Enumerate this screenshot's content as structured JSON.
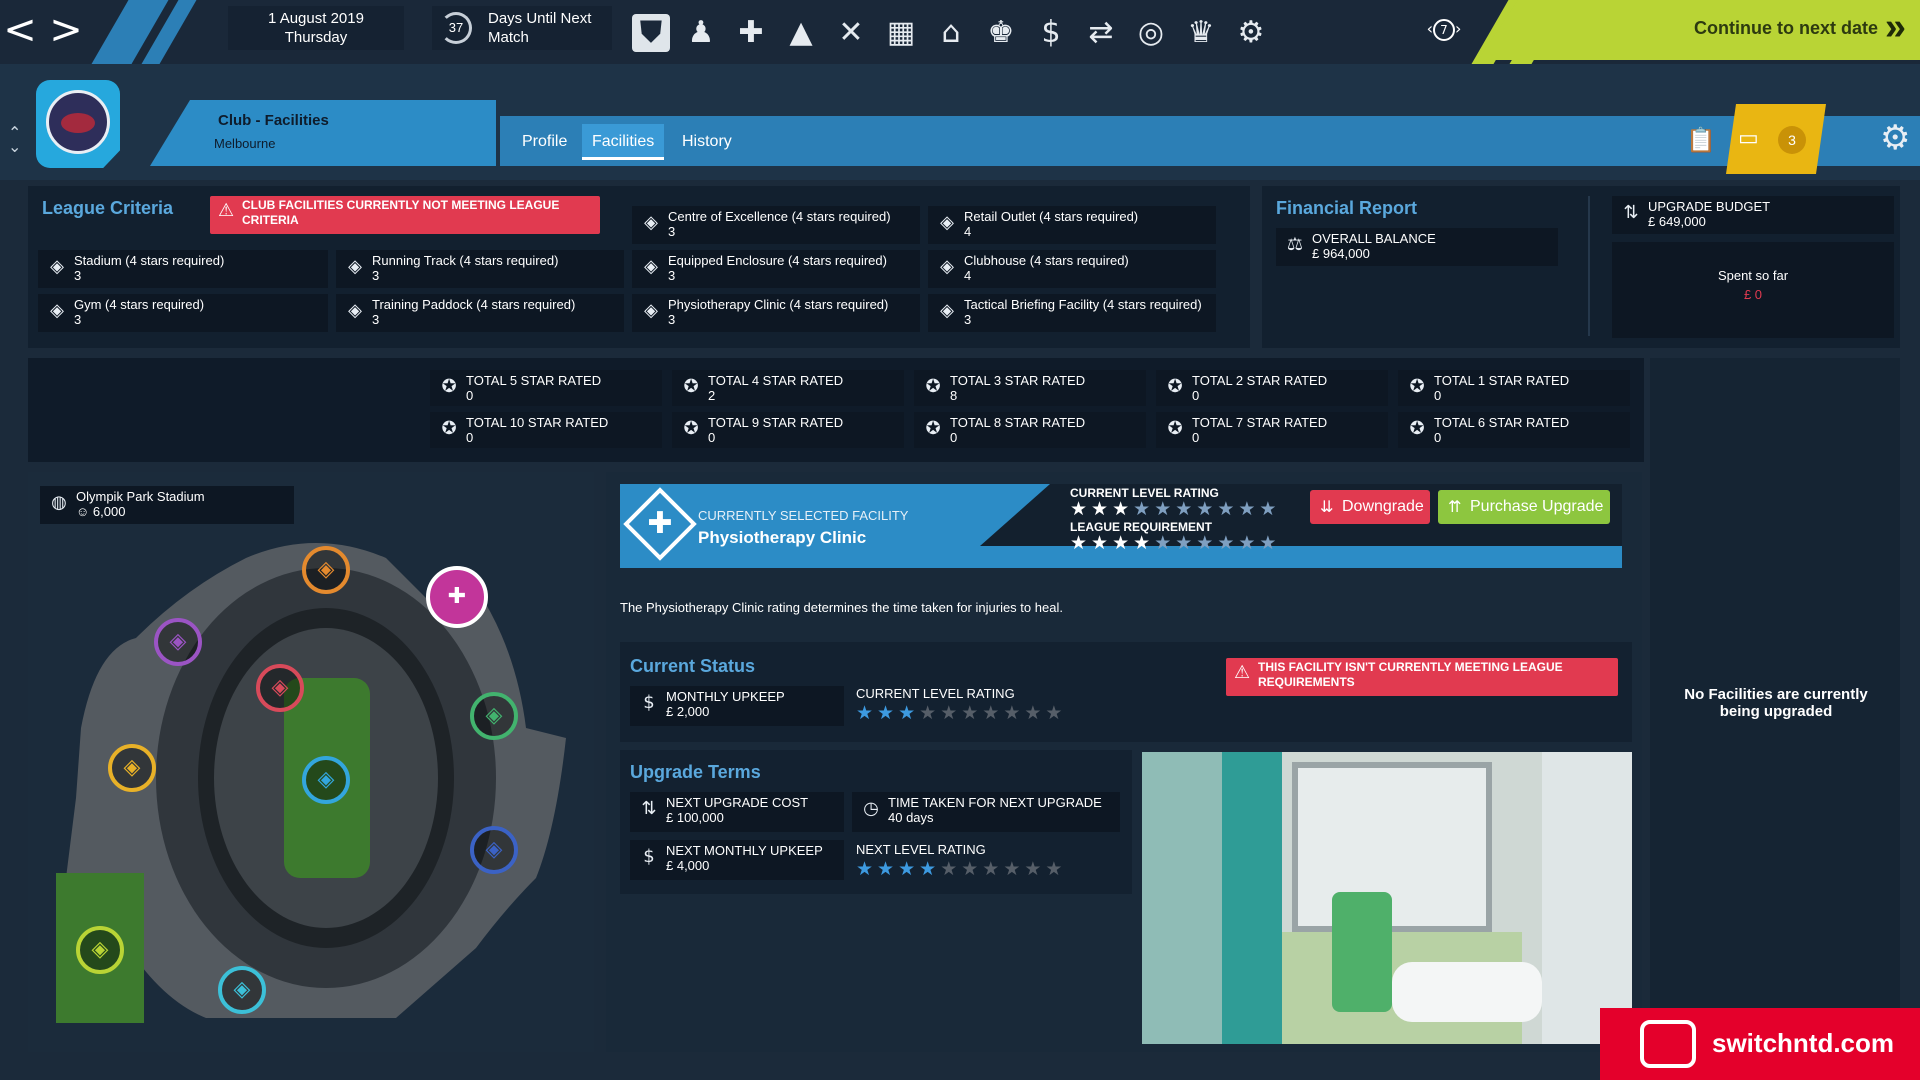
{
  "topbar": {
    "date": "1 August 2019",
    "day": "Thursday",
    "days_count": "37",
    "days_label_1": "Days Until Next",
    "days_label_2": "Match",
    "back_glyph": "<",
    "forward_glyph": ">",
    "history_count": "7",
    "continue_label": "Continue to next date",
    "icons": [
      "club-shield-icon",
      "squad-icon",
      "medical-icon",
      "training-cone-icon",
      "tactics-icon",
      "calendar-icon",
      "home-icon",
      "staff-icon",
      "finance-icon",
      "transfers-icon",
      "scouting-icon",
      "trophy-icon",
      "board-icon"
    ]
  },
  "header": {
    "breadcrumb": "Club - Facilities",
    "location": "Melbourne",
    "tabs": [
      {
        "label": "Profile"
      },
      {
        "label": "Facilities"
      },
      {
        "label": "History"
      }
    ],
    "notifications_count": "3"
  },
  "league_criteria": {
    "title": "League Criteria",
    "alert": "CLUB FACILITIES CURRENTLY NOT MEETING LEAGUE CRITERIA",
    "items": [
      {
        "label": "Centre of Excellence (4 stars required)",
        "value": "3"
      },
      {
        "label": "Retail Outlet (4 stars required)",
        "value": "4"
      },
      {
        "label": "Stadium (4 stars required)",
        "value": "3"
      },
      {
        "label": "Running Track (4 stars required)",
        "value": "3"
      },
      {
        "label": "Equipped Enclosure (4 stars required)",
        "value": "3"
      },
      {
        "label": "Clubhouse (4 stars required)",
        "value": "4"
      },
      {
        "label": "Gym (4 stars required)",
        "value": "3"
      },
      {
        "label": "Training Paddock (4 stars required)",
        "value": "3"
      },
      {
        "label": "Physiotherapy Clinic (4 stars required)",
        "value": "3"
      },
      {
        "label": "Tactical Briefing Facility (4 stars required)",
        "value": "3"
      }
    ]
  },
  "financial": {
    "title": "Financial Report",
    "overall_label": "OVERALL BALANCE",
    "overall_value": "£ 964,000",
    "budget_label": "UPGRADE BUDGET",
    "budget_value": "£ 649,000",
    "spent_label": "Spent so far",
    "spent_value": "£ 0"
  },
  "totals": [
    {
      "label": "TOTAL 5 STAR RATED",
      "value": "0"
    },
    {
      "label": "TOTAL 4 STAR RATED",
      "value": "2"
    },
    {
      "label": "TOTAL 3 STAR RATED",
      "value": "8"
    },
    {
      "label": "TOTAL 2 STAR RATED",
      "value": "0"
    },
    {
      "label": "TOTAL 1 STAR RATED",
      "value": "0"
    },
    {
      "label": "TOTAL 10 STAR RATED",
      "value": "0"
    },
    {
      "label": "TOTAL 9 STAR RATED",
      "value": "0"
    },
    {
      "label": "TOTAL 8 STAR RATED",
      "value": "0"
    },
    {
      "label": "TOTAL 7 STAR RATED",
      "value": "0"
    },
    {
      "label": "TOTAL 6 STAR RATED",
      "value": "0"
    }
  ],
  "stadium": {
    "name": "Olympik Park Stadium",
    "capacity": "6,000"
  },
  "selected": {
    "caption": "CURRENTLY SELECTED FACILITY",
    "name": "Physiotherapy Clinic",
    "current_label": "CURRENT LEVEL RATING",
    "current_rating": 3,
    "req_label": "LEAGUE REQUIREMENT",
    "req_rating": 4,
    "downgrade_label": "Downgrade",
    "upgrade_label": "Purchase Upgrade",
    "description": "The Physiotherapy Clinic rating determines the time taken for injuries to heal."
  },
  "current_status": {
    "title": "Current Status",
    "upkeep_label": "MONTHLY UPKEEP",
    "upkeep_value": "£ 2,000",
    "rating_label": "CURRENT LEVEL RATING",
    "rating": 3,
    "alert": "THIS FACILITY ISN'T CURRENTLY MEETING LEAGUE REQUIREMENTS"
  },
  "upgrade_terms": {
    "title": "Upgrade Terms",
    "cost_label": "NEXT UPGRADE COST",
    "cost_value": "£ 100,000",
    "time_label": "TIME TAKEN FOR NEXT UPGRADE",
    "time_value": "40 days",
    "next_upkeep_label": "NEXT MONTHLY UPKEEP",
    "next_upkeep_value": "£ 4,000",
    "next_rating_label": "NEXT LEVEL RATING",
    "next_rating": 4
  },
  "upgrades_panel": {
    "empty_text": "No Facilities are currently being upgraded"
  },
  "watermark": {
    "text": "switchntd.com"
  },
  "colors": {
    "accent": "#2c8cc6",
    "alert": "#e13a50",
    "positive": "#9ccd3a",
    "star_on": "#3d9ae0"
  }
}
